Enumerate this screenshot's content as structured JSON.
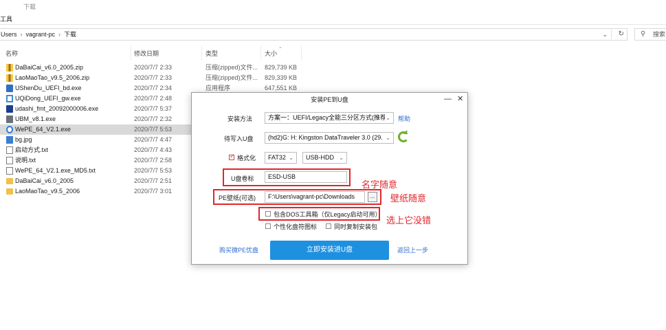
{
  "ribbon": {
    "tab_download": "下载",
    "tools": "工具"
  },
  "address": {
    "crumbs": [
      "Users",
      "vagrant-pc",
      "下载"
    ],
    "down": "⌄",
    "refresh": "↻"
  },
  "search": {
    "placeholder": "搜索"
  },
  "columns": {
    "name": "名称",
    "date": "修改日期",
    "type": "类型",
    "size": "大小"
  },
  "files": [
    {
      "name": "DaBaiCai_v6.0_2005.zip",
      "date": "2020/7/7 2:33",
      "type": "压缩(zipped)文件...",
      "size": "829,739 KB",
      "icon": "zip"
    },
    {
      "name": "LaoMaoTao_v9.5_2006.zip",
      "date": "2020/7/7 2:33",
      "type": "压缩(zipped)文件...",
      "size": "829,339 KB",
      "icon": "zip"
    },
    {
      "name": "UShenDu_UEFI_bd.exe",
      "date": "2020/7/7 2:34",
      "type": "应用程序",
      "size": "647,551 KB",
      "icon": "exe-blue"
    },
    {
      "name": "UQiDong_UEFI_gw.exe",
      "date": "2020/7/7 2:48",
      "type": "",
      "size": "",
      "icon": "exe-green"
    },
    {
      "name": "udashi_fmt_20092000006.exe",
      "date": "2020/7/7 5:37",
      "type": "",
      "size": "",
      "icon": "exe-navy"
    },
    {
      "name": "UBM_v8.1.exe",
      "date": "2020/7/7 2:32",
      "type": "",
      "size": "",
      "icon": "exe-gray"
    },
    {
      "name": "WePE_64_V2.1.exe",
      "date": "2020/7/7 5:53",
      "type": "",
      "size": "",
      "icon": "exe-we"
    },
    {
      "name": "bg.jpg",
      "date": "2020/7/7 4:47",
      "type": "",
      "size": "",
      "icon": "img"
    },
    {
      "name": "启动方式.txt",
      "date": "2020/7/7 4:43",
      "type": "",
      "size": "",
      "icon": "txt"
    },
    {
      "name": "说明.txt",
      "date": "2020/7/7 2:58",
      "type": "",
      "size": "",
      "icon": "txt"
    },
    {
      "name": "WePE_64_V2.1.exe_MD5.txt",
      "date": "2020/7/7 5:53",
      "type": "",
      "size": "",
      "icon": "txt"
    },
    {
      "name": "DaBaiCai_v6.0_2005",
      "date": "2020/7/7 2:51",
      "type": "",
      "size": "",
      "icon": "folder"
    },
    {
      "name": "LaoMaoTao_v9.5_2006",
      "date": "2020/7/7 3:01",
      "type": "",
      "size": "",
      "icon": "folder"
    }
  ],
  "dialog": {
    "title": "安装PE到U盘",
    "minimize": "—",
    "close": "✕",
    "install_method_label": "安装方法",
    "install_method_value": "方案一：UEFI/Legacy全能三分区方式(推荐)",
    "help": "帮助",
    "target_label": "待写入U盘",
    "target_value": "(hd2)G: H: Kingston DataTraveler 3.0 (29.",
    "format_label": "格式化",
    "fs_value": "FAT32",
    "mode_value": "USB-HDD",
    "volume_label": "U盘卷标",
    "volume_value": "ESD-USB",
    "wallpaper_label": "PE壁纸(可选)",
    "wallpaper_value": "F:\\Users\\vagrant-pc\\Downloads",
    "browse": "...",
    "dos_tools": "包含DOS工具箱（仅Legacy启动可用）",
    "custom_icon": "个性化盘符图标",
    "copy_pkg": "同时复制安装包",
    "buy": "购买微PE优盘",
    "install": "立即安装进U盘",
    "back": "返回上一步"
  },
  "annotations": {
    "name_note": "名字随意",
    "wallpaper_note": "壁纸随意",
    "dos_note": "选上它没错"
  },
  "colors": {
    "accent": "#1e90e0",
    "annotation": "#e0262b",
    "selection": "#d9d9d9"
  }
}
